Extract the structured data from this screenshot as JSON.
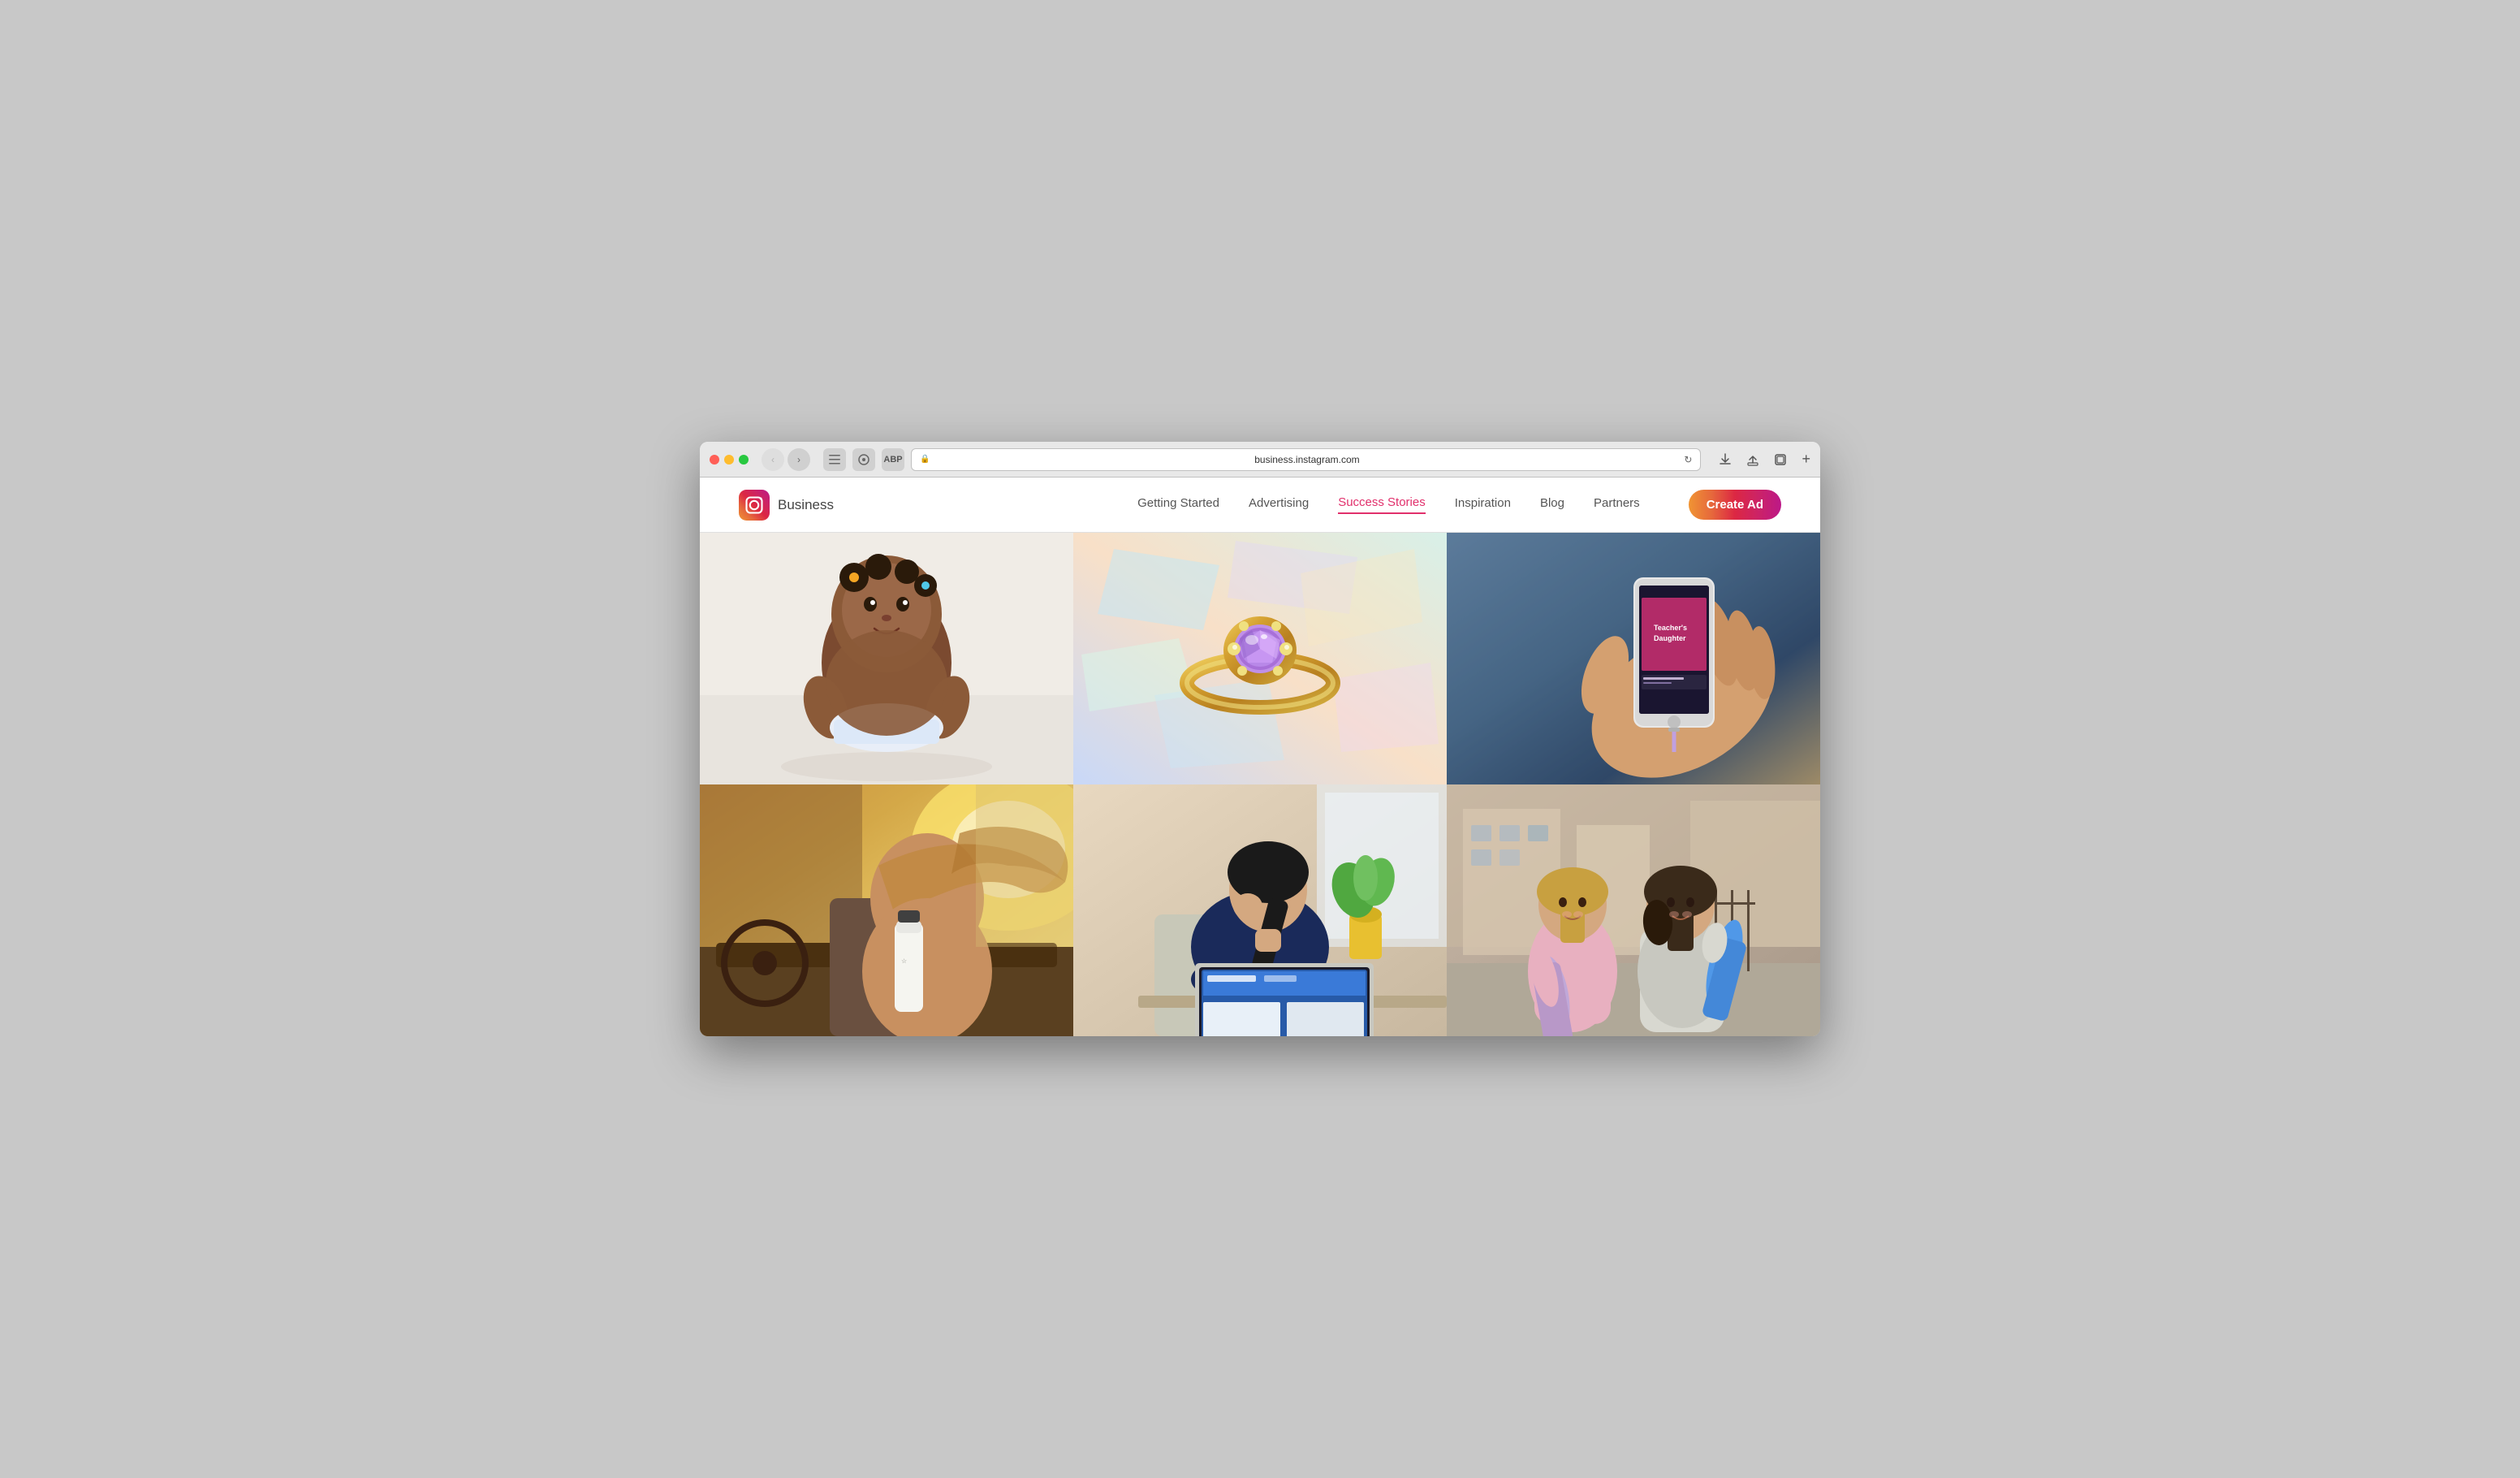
{
  "browser": {
    "url": "business.instagram.com",
    "tab_title": "business.instagram.com"
  },
  "header": {
    "brand": "Business",
    "logo_alt": "Instagram logo",
    "nav": {
      "items": [
        {
          "label": "Getting Started",
          "active": false
        },
        {
          "label": "Advertising",
          "active": false
        },
        {
          "label": "Success Stories",
          "active": true
        },
        {
          "label": "Inspiration",
          "active": false
        },
        {
          "label": "Blog",
          "active": false
        },
        {
          "label": "Partners",
          "active": false
        }
      ],
      "cta_label": "Create Ad"
    }
  },
  "grid": {
    "cells": [
      {
        "id": "baby",
        "description": "Baby crawling on white background",
        "row": 1,
        "col": 1
      },
      {
        "id": "ring",
        "description": "Diamond ring on holographic background",
        "row": 1,
        "col": 2
      },
      {
        "id": "phone",
        "description": "Hand holding phone showing app",
        "row": 1,
        "col": 3
      },
      {
        "id": "bottle",
        "description": "Woman in car holding water bottle",
        "row": 2,
        "col": 1
      },
      {
        "id": "laptop",
        "description": "Woman working on laptop",
        "row": 2,
        "col": 2
      },
      {
        "id": "women",
        "description": "Two women with yoga mats",
        "row": 2,
        "col": 3
      }
    ]
  }
}
